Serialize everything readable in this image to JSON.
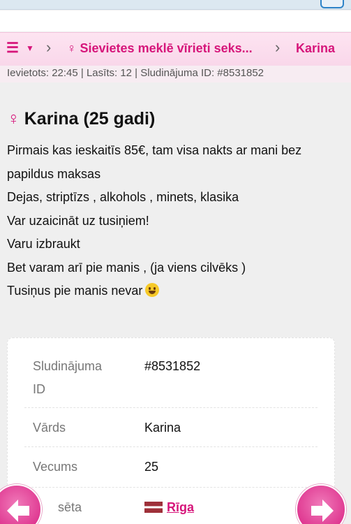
{
  "breadcrumb": {
    "category": "Sievietes meklē vīrieti seks...",
    "current": "Karina"
  },
  "meta": {
    "text": "Ievietots: 22:45 | Lasīts: 12 | Sludinājuma ID: #8531852"
  },
  "ad": {
    "gender_symbol": "♀",
    "title": "Karina (25 gadi)",
    "lines": [
      "Pirmais kas ieskaitīs 85€, tam visa nakts ar mani bez papildus maksas",
      "Dejas, striptīzs , alkohols , minets, klasika",
      "Var uzaicināt uz tusiņiem!",
      "Varu izbraukt",
      "Bet varam arī pie manis , (ja viens cilvēks )",
      "Tusiņus pie manis nevar"
    ]
  },
  "details": {
    "ad_id_label": "Sludinājuma ID",
    "ad_id_value": "#8531852",
    "name_label": "Vārds",
    "name_value": "Karina",
    "age_label": "Vecums",
    "age_value": "25",
    "city_label": "sēta",
    "city_value": "Rīga"
  },
  "colors": {
    "accent": "#d6157a",
    "crumb_bg": "#fde4f1",
    "page_bg": "#efefef"
  },
  "icons": {
    "menu": "list-icon",
    "prev": "arrow-left-icon",
    "next": "arrow-right-icon",
    "emoji": "grinning-face-icon",
    "flag": "latvia-flag-icon"
  }
}
